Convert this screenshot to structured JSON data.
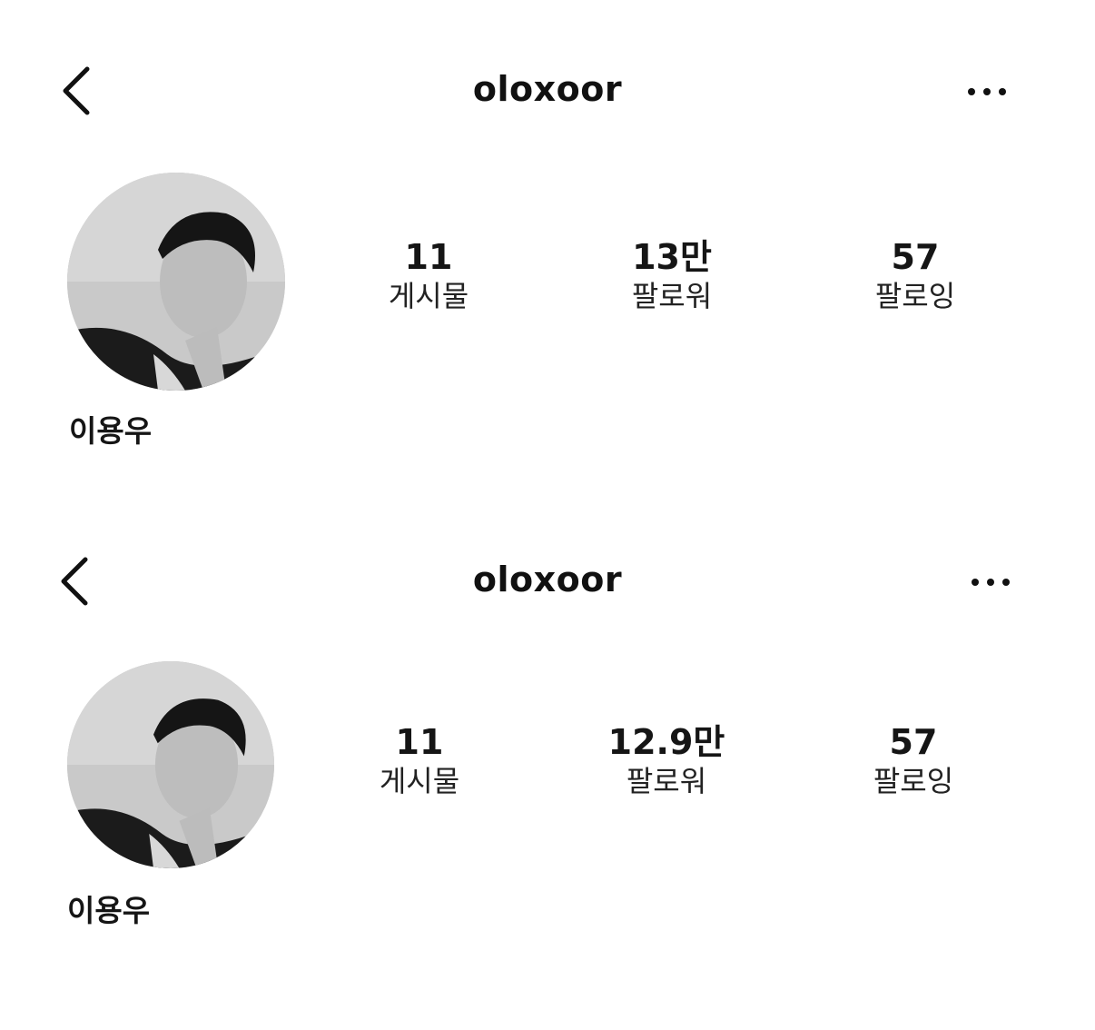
{
  "profiles": [
    {
      "username": "oloxoor",
      "display_name": "이용우",
      "stats": [
        {
          "value": "11",
          "label": "게시물"
        },
        {
          "value": "13만",
          "label": "팔로워"
        },
        {
          "value": "57",
          "label": "팔로잉"
        }
      ]
    },
    {
      "username": "oloxoor",
      "display_name": "이용우",
      "stats": [
        {
          "value": "11",
          "label": "게시물"
        },
        {
          "value": "12.9만",
          "label": "팔로워"
        },
        {
          "value": "57",
          "label": "팔로잉"
        }
      ]
    }
  ],
  "icons": {
    "back": "chevron-left-icon",
    "more": "more-horizontal-icon"
  },
  "colors": {
    "background": "#ffffff",
    "text": "#111111"
  }
}
